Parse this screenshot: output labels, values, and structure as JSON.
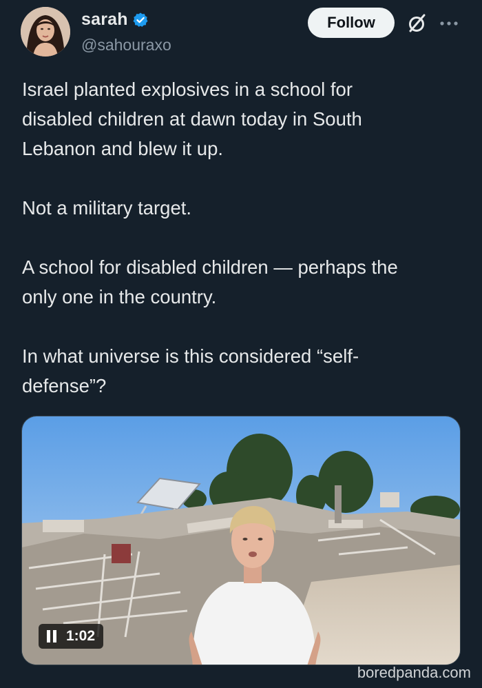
{
  "header": {
    "display_name": "sarah",
    "handle": "@sahouraxo",
    "follow_label": "Follow"
  },
  "tweet": {
    "text": "Israel planted explosives in a school for\ndisabled children at dawn today in South\nLebanon and blew it up.\n\nNot a military target.\n\nA school for disabled children — perhaps the\nonly one in the country.\n\nIn what universe is this considered “self-\ndefense”?"
  },
  "video": {
    "time": "1:02"
  },
  "icons": {
    "verified": "verified-badge-icon",
    "grok": "grok-icon",
    "more": "more-icon",
    "pause": "pause-icon"
  },
  "colors": {
    "background": "#15202b",
    "verified": "#1d9bf0",
    "follow_bg": "#eff3f4",
    "muted": "#8b98a5"
  },
  "watermark": "boredpanda.com"
}
